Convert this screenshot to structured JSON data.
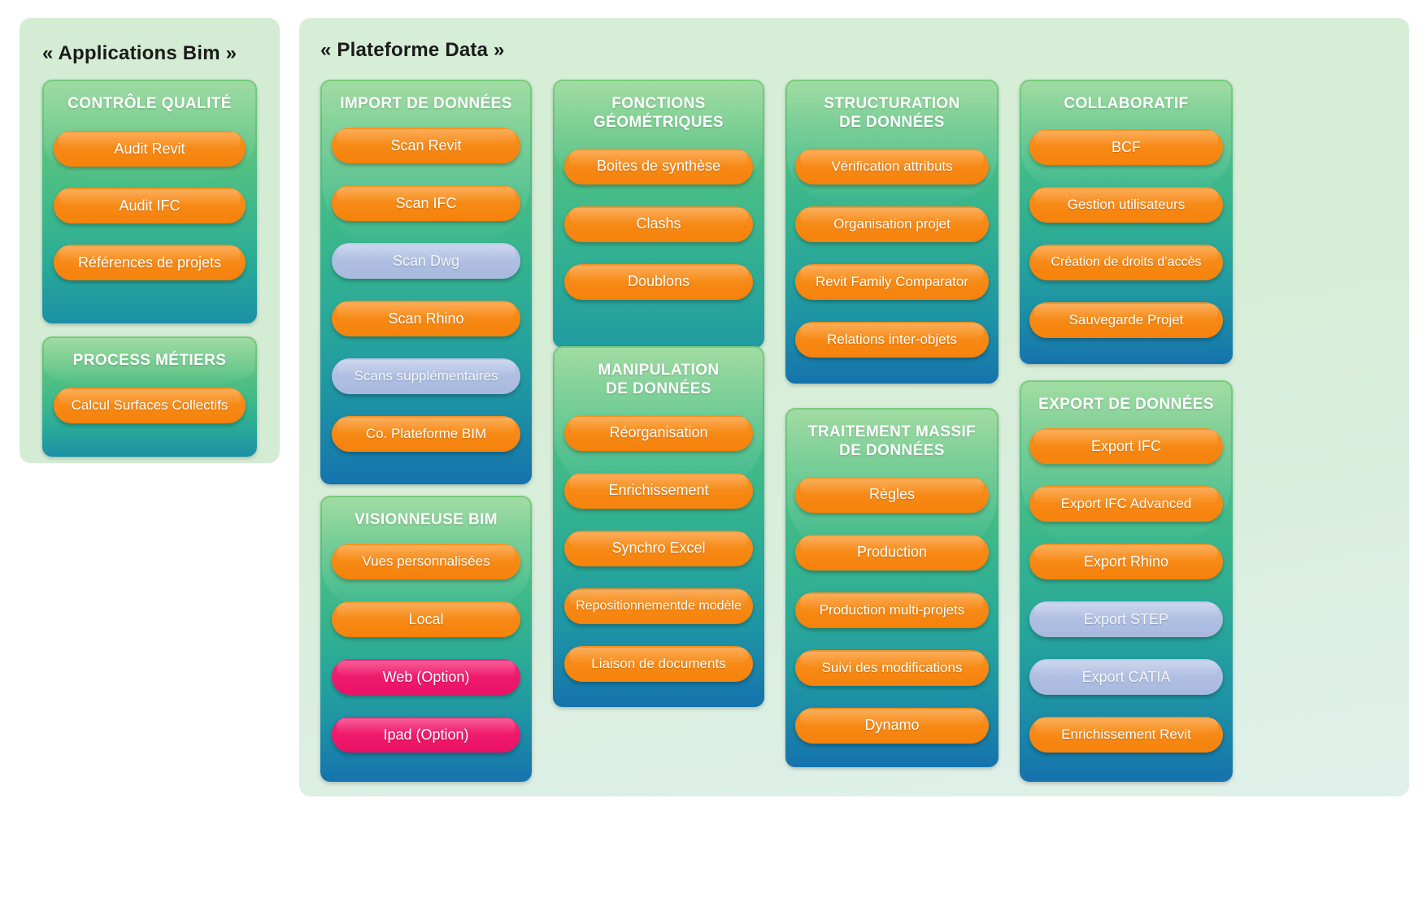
{
  "panels": [
    {
      "id": "applications-bim",
      "title": "« Applications Bim »",
      "cards": [
        {
          "id": "controle-qualite",
          "title": "CONTRÔLE QUALITÉ",
          "items": [
            {
              "label": "Audit Revit",
              "color": "orange"
            },
            {
              "label": "Audit IFC",
              "color": "orange"
            },
            {
              "label": "Références de projets",
              "color": "orange"
            }
          ]
        },
        {
          "id": "process-metiers",
          "title": "PROCESS MÉTIERS",
          "items": [
            {
              "label": "Calcul Surfaces Collectifs",
              "color": "orange"
            }
          ]
        }
      ]
    },
    {
      "id": "plateforme-data",
      "title": "« Plateforme  Data »",
      "cards": [
        {
          "id": "import-de-donnees",
          "title": "IMPORT DE DONNÉES",
          "items": [
            {
              "label": "Scan Revit",
              "color": "orange"
            },
            {
              "label": "Scan IFC",
              "color": "orange"
            },
            {
              "label": "Scan Dwg",
              "color": "blue"
            },
            {
              "label": "Scan Rhino",
              "color": "orange"
            },
            {
              "label": "Scans supplémentaires",
              "color": "blue"
            },
            {
              "label": "Co. Plateforme BIM",
              "color": "orange"
            }
          ]
        },
        {
          "id": "visionneuse-bim",
          "title": "VISIONNEUSE BIM",
          "items": [
            {
              "label": "Vues personnalisées",
              "color": "orange"
            },
            {
              "label": "Local",
              "color": "orange"
            },
            {
              "label": "Web (Option)",
              "color": "pink"
            },
            {
              "label": "Ipad (Option)",
              "color": "pink"
            }
          ]
        },
        {
          "id": "fonctions-geometriques",
          "title": "FONCTIONS GÉOMÉTRIQUES",
          "title_line1": "FONCTIONS",
          "title_line2": "GÉOMÉTRIQUES",
          "items": [
            {
              "label": "Boites de synthèse",
              "color": "orange"
            },
            {
              "label": "Clashs",
              "color": "orange"
            },
            {
              "label": "Doublons",
              "color": "orange"
            }
          ]
        },
        {
          "id": "manipulation-de-donnees",
          "title": "MANIPULATION DE DONNÉES",
          "title_line1": "MANIPULATION",
          "title_line2": "DE DONNÉES",
          "items": [
            {
              "label": "Réorganisation",
              "color": "orange"
            },
            {
              "label": "Enrichissement",
              "color": "orange"
            },
            {
              "label": "Synchro Excel",
              "color": "orange"
            },
            {
              "label": "Repositionnement de modèle",
              "color": "orange",
              "line1": "Repositionnement",
              "line2": "de modèle"
            },
            {
              "label": "Liaison de documents",
              "color": "orange"
            }
          ]
        },
        {
          "id": "structuration-de-donnees",
          "title": "STRUCTURATION DE DONNÉES",
          "title_line1": "STRUCTURATION",
          "title_line2": "DE DONNÉES",
          "items": [
            {
              "label": "Vérification attributs",
              "color": "orange"
            },
            {
              "label": "Organisation projet",
              "color": "orange"
            },
            {
              "label": "Revit Family Comparator",
              "color": "orange"
            },
            {
              "label": "Relations inter-objets",
              "color": "orange"
            }
          ]
        },
        {
          "id": "traitement-massif-de-donnees",
          "title": "TRAITEMENT MASSIF DE DONNÉES",
          "title_line1": "TRAITEMENT MASSIF",
          "title_line2": "DE DONNÉES",
          "items": [
            {
              "label": "Règles",
              "color": "orange"
            },
            {
              "label": "Production",
              "color": "orange"
            },
            {
              "label": "Production multi-projets",
              "color": "orange"
            },
            {
              "label": "Suivi des modifications",
              "color": "orange"
            },
            {
              "label": "Dynamo",
              "color": "orange"
            }
          ]
        },
        {
          "id": "collaboratif",
          "title": "COLLABORATIF",
          "items": [
            {
              "label": "BCF",
              "color": "orange"
            },
            {
              "label": "Gestion utilisateurs",
              "color": "orange"
            },
            {
              "label": "Création de droits d’accès",
              "color": "orange"
            },
            {
              "label": "Sauvegarde Projet",
              "color": "orange"
            }
          ]
        },
        {
          "id": "export-de-donnees",
          "title": "EXPORT DE DONNÉES",
          "items": [
            {
              "label": "Export IFC",
              "color": "orange"
            },
            {
              "label": "Export IFC Advanced",
              "color": "orange"
            },
            {
              "label": "Export Rhino",
              "color": "orange"
            },
            {
              "label": "Export STEP",
              "color": "blue"
            },
            {
              "label": "Export CATIA",
              "color": "blue"
            },
            {
              "label": "Enrichissement Revit",
              "color": "orange"
            }
          ]
        }
      ]
    }
  ],
  "colors": {
    "panel_background": "#d4ecd4",
    "card_gradient_top": "#76cc7c",
    "card_gradient_bottom": "#1573ad",
    "pill_orange": "#f7891a",
    "pill_blue": "#b0c0e2",
    "pill_pink": "#ef1a6b",
    "title_text": "#1a1a1a",
    "card_title_text": "#ffffff"
  }
}
